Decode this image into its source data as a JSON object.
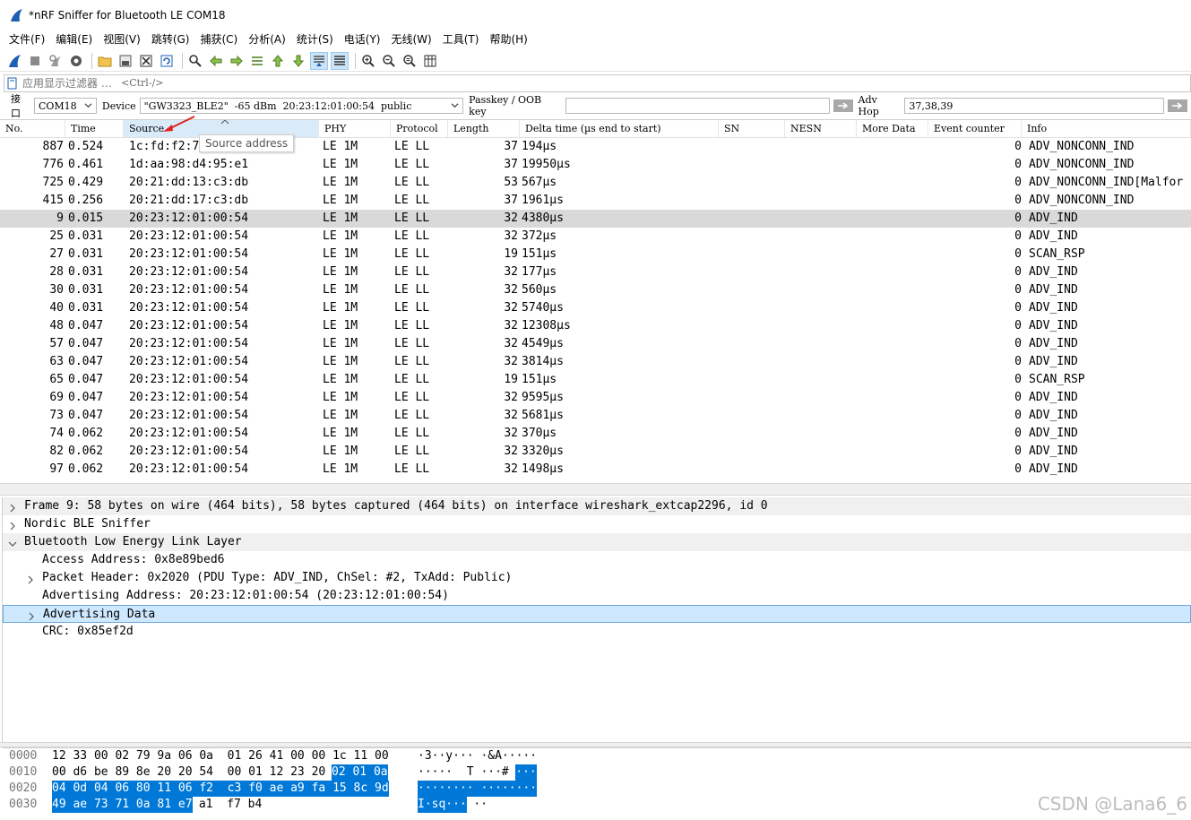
{
  "window": {
    "title": "*nRF Sniffer for Bluetooth LE COM18"
  },
  "menu": [
    "文件(F)",
    "编辑(E)",
    "视图(V)",
    "跳转(G)",
    "捕获(C)",
    "分析(A)",
    "统计(S)",
    "电话(Y)",
    "无线(W)",
    "工具(T)",
    "帮助(H)"
  ],
  "toolbar_icons": [
    "shark-fin-start-icon",
    "stop-square-icon",
    "restart-icon",
    "options-gear-icon",
    "open-folder-icon",
    "save-file-icon",
    "close-file-icon",
    "reload-icon",
    "find-magnifier-icon",
    "go-back-icon",
    "go-forward-icon",
    "go-to-packet-icon",
    "go-first-icon",
    "go-last-icon",
    "autoscroll-icon",
    "colorize-icon",
    "zoom-in-icon",
    "zoom-out-icon",
    "zoom-normal-icon",
    "resize-columns-icon"
  ],
  "filter": {
    "label": "应用显示过滤器 …",
    "shortcut": "<Ctrl-/>"
  },
  "iface": {
    "interface_label": "接口",
    "interface_value": "COM18",
    "device_label": "Device",
    "device_value": "\"GW3323_BLE2\"  -65 dBm  20:23:12:01:00:54  public",
    "passkey_label": "Passkey / OOB key",
    "passkey_value": "",
    "advhop_label": "Adv Hop",
    "advhop_value": "37,38,39"
  },
  "columns": {
    "no": "No.",
    "time": "Time",
    "source": "Source",
    "phy": "PHY",
    "protocol": "Protocol",
    "length": "Length",
    "delta": "Delta time (µs end to start)",
    "sn": "SN",
    "nesn": "NESN",
    "more": "More Data",
    "event": "Event counter",
    "info": "Info"
  },
  "tooltip": "Source address",
  "packets": [
    {
      "no": "887",
      "time": "0.524",
      "src": "1c:fd:f2:7",
      "phy": "LE 1M",
      "proto": "LE LL",
      "len": "37",
      "delta": "194µs",
      "ev": "0",
      "info": "ADV_NONCONN_IND"
    },
    {
      "no": "776",
      "time": "0.461",
      "src": "1d:aa:98:d4:95:e1",
      "phy": "LE 1M",
      "proto": "LE LL",
      "len": "37",
      "delta": "19950µs",
      "ev": "0",
      "info": "ADV_NONCONN_IND"
    },
    {
      "no": "725",
      "time": "0.429",
      "src": "20:21:dd:13:c3:db",
      "phy": "LE 1M",
      "proto": "LE LL",
      "len": "53",
      "delta": "567µs",
      "ev": "0",
      "info": "ADV_NONCONN_IND[Malfor"
    },
    {
      "no": "415",
      "time": "0.256",
      "src": "20:21:dd:17:c3:db",
      "phy": "LE 1M",
      "proto": "LE LL",
      "len": "37",
      "delta": "1961µs",
      "ev": "0",
      "info": "ADV_NONCONN_IND"
    },
    {
      "no": "9",
      "time": "0.015",
      "src": "20:23:12:01:00:54",
      "phy": "LE 1M",
      "proto": "LE LL",
      "len": "32",
      "delta": "4380µs",
      "ev": "0",
      "info": "ADV_IND"
    },
    {
      "no": "25",
      "time": "0.031",
      "src": "20:23:12:01:00:54",
      "phy": "LE 1M",
      "proto": "LE LL",
      "len": "32",
      "delta": "372µs",
      "ev": "0",
      "info": "ADV_IND"
    },
    {
      "no": "27",
      "time": "0.031",
      "src": "20:23:12:01:00:54",
      "phy": "LE 1M",
      "proto": "LE LL",
      "len": "19",
      "delta": "151µs",
      "ev": "0",
      "info": "SCAN_RSP"
    },
    {
      "no": "28",
      "time": "0.031",
      "src": "20:23:12:01:00:54",
      "phy": "LE 1M",
      "proto": "LE LL",
      "len": "32",
      "delta": "177µs",
      "ev": "0",
      "info": "ADV_IND"
    },
    {
      "no": "30",
      "time": "0.031",
      "src": "20:23:12:01:00:54",
      "phy": "LE 1M",
      "proto": "LE LL",
      "len": "32",
      "delta": "560µs",
      "ev": "0",
      "info": "ADV_IND"
    },
    {
      "no": "40",
      "time": "0.031",
      "src": "20:23:12:01:00:54",
      "phy": "LE 1M",
      "proto": "LE LL",
      "len": "32",
      "delta": "5740µs",
      "ev": "0",
      "info": "ADV_IND"
    },
    {
      "no": "48",
      "time": "0.047",
      "src": "20:23:12:01:00:54",
      "phy": "LE 1M",
      "proto": "LE LL",
      "len": "32",
      "delta": "12308µs",
      "ev": "0",
      "info": "ADV_IND"
    },
    {
      "no": "57",
      "time": "0.047",
      "src": "20:23:12:01:00:54",
      "phy": "LE 1M",
      "proto": "LE LL",
      "len": "32",
      "delta": "4549µs",
      "ev": "0",
      "info": "ADV_IND"
    },
    {
      "no": "63",
      "time": "0.047",
      "src": "20:23:12:01:00:54",
      "phy": "LE 1M",
      "proto": "LE LL",
      "len": "32",
      "delta": "3814µs",
      "ev": "0",
      "info": "ADV_IND"
    },
    {
      "no": "65",
      "time": "0.047",
      "src": "20:23:12:01:00:54",
      "phy": "LE 1M",
      "proto": "LE LL",
      "len": "19",
      "delta": "151µs",
      "ev": "0",
      "info": "SCAN_RSP"
    },
    {
      "no": "69",
      "time": "0.047",
      "src": "20:23:12:01:00:54",
      "phy": "LE 1M",
      "proto": "LE LL",
      "len": "32",
      "delta": "9595µs",
      "ev": "0",
      "info": "ADV_IND"
    },
    {
      "no": "73",
      "time": "0.047",
      "src": "20:23:12:01:00:54",
      "phy": "LE 1M",
      "proto": "LE LL",
      "len": "32",
      "delta": "5681µs",
      "ev": "0",
      "info": "ADV_IND"
    },
    {
      "no": "74",
      "time": "0.062",
      "src": "20:23:12:01:00:54",
      "phy": "LE 1M",
      "proto": "LE LL",
      "len": "32",
      "delta": "370µs",
      "ev": "0",
      "info": "ADV_IND"
    },
    {
      "no": "82",
      "time": "0.062",
      "src": "20:23:12:01:00:54",
      "phy": "LE 1M",
      "proto": "LE LL",
      "len": "32",
      "delta": "3320µs",
      "ev": "0",
      "info": "ADV_IND"
    },
    {
      "no": "97",
      "time": "0.062",
      "src": "20:23:12:01:00:54",
      "phy": "LE 1M",
      "proto": "LE LL",
      "len": "32",
      "delta": "1498µs",
      "ev": "0",
      "info": "ADV_IND"
    }
  ],
  "selected_packet_index": 4,
  "details": [
    {
      "text": "Frame 9: 58 bytes on wire (464 bits), 58 bytes captured (464 bits) on interface wireshark_extcap2296, id 0",
      "level": 0,
      "exp": "collapsed",
      "style": "shaded"
    },
    {
      "text": "Nordic BLE Sniffer",
      "level": 0,
      "exp": "collapsed",
      "style": ""
    },
    {
      "text": "Bluetooth Low Energy Link Layer",
      "level": 0,
      "exp": "expanded",
      "style": "shaded"
    },
    {
      "text": "Access Address: 0x8e89bed6",
      "level": 1,
      "exp": "none",
      "style": ""
    },
    {
      "text": "Packet Header: 0x2020 (PDU Type: ADV_IND, ChSel: #2, TxAdd: Public)",
      "level": 1,
      "exp": "collapsed",
      "style": ""
    },
    {
      "text": "Advertising Address: 20:23:12:01:00:54 (20:23:12:01:00:54)",
      "level": 1,
      "exp": "none",
      "style": ""
    },
    {
      "text": "Advertising Data",
      "level": 1,
      "exp": "collapsed",
      "style": "hl"
    },
    {
      "text": "CRC: 0x85ef2d",
      "level": 1,
      "exp": "none",
      "style": ""
    }
  ],
  "bytes": [
    {
      "off": "0000",
      "hex_plain": "12 33 00 02 79 9a 06 0a  01 26 41 00 00 1c 11 00",
      "hex_sel": "",
      "hex_after": "",
      "asc_plain": "·3··y··· ·&A·····",
      "asc_sel": "",
      "asc_after": ""
    },
    {
      "off": "0010",
      "hex_plain": "00 d6 be 89 8e 20 20 54  00 01 12 23 20 ",
      "hex_sel": "02 01 0a",
      "hex_after": "",
      "asc_plain": "·····  T ···# ",
      "asc_sel": "···",
      "asc_after": ""
    },
    {
      "off": "0020",
      "hex_plain": "",
      "hex_sel": "04 0d 04 06 80 11 06 f2  c3 f0 ae a9 fa 15 8c 9d",
      "hex_after": "",
      "asc_plain": "",
      "asc_sel": "········ ········",
      "asc_after": ""
    },
    {
      "off": "0030",
      "hex_plain": "",
      "hex_sel": "49 ae 73 71 0a 81 e7",
      "hex_after": " a1  f7 b4",
      "asc_plain": "",
      "asc_sel": "I·sq···",
      "asc_after": " ··"
    }
  ],
  "watermark": "CSDN @Lana6_6"
}
